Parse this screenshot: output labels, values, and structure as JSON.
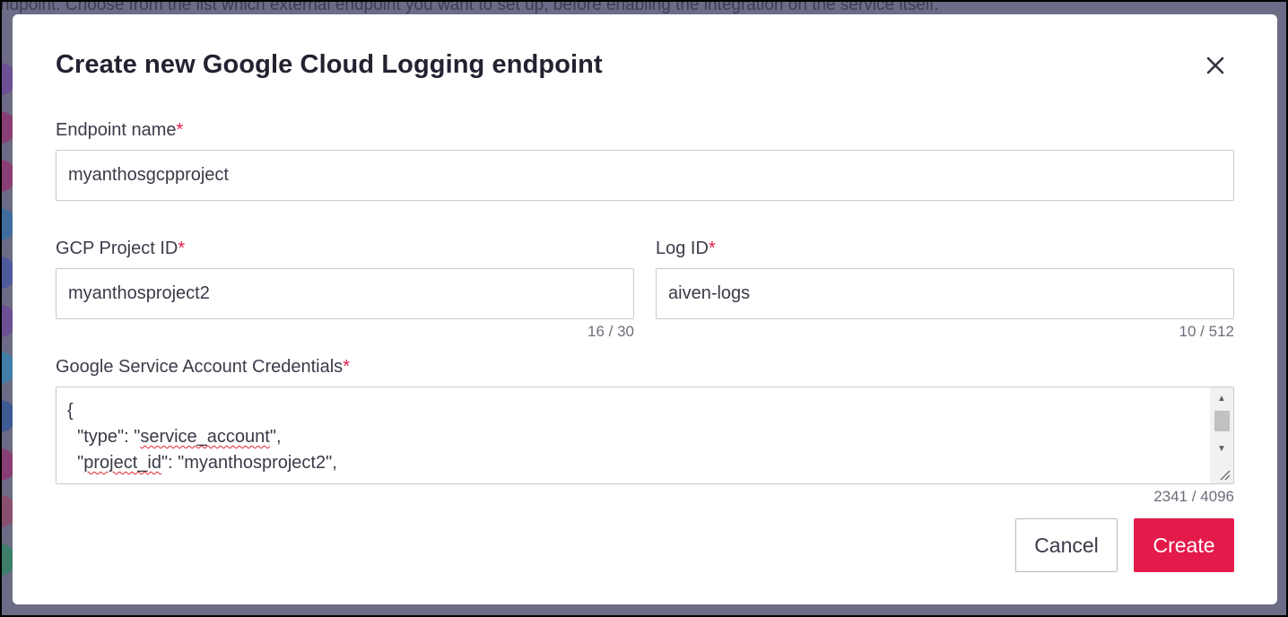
{
  "background": {
    "text": "ndpoint. Choose from the list which external endpoint you want to set up, before enabling the integration on the service itself."
  },
  "modal": {
    "title": "Create new Google Cloud Logging endpoint",
    "close_icon": "close-icon"
  },
  "form": {
    "required_marker": "*",
    "endpoint_name": {
      "label": "Endpoint name",
      "value": "myanthosgcpproject"
    },
    "gcp_project_id": {
      "label": "GCP Project ID",
      "value": "myanthosproject2",
      "counter": "16 / 30"
    },
    "log_id": {
      "label": "Log ID",
      "value": "aiven-logs",
      "counter": "10 / 512"
    },
    "credentials": {
      "label": "Google Service Account Credentials",
      "lines": [
        "{",
        "  \"type\": \"service_account\",",
        "  \"project_id\": \"myanthosproject2\","
      ],
      "counter": "2341 / 4096"
    }
  },
  "actions": {
    "cancel_label": "Cancel",
    "create_label": "Create"
  },
  "colors": {
    "accent": "#e41a4b",
    "overlay": "#6d6c86",
    "title": "#222230"
  }
}
